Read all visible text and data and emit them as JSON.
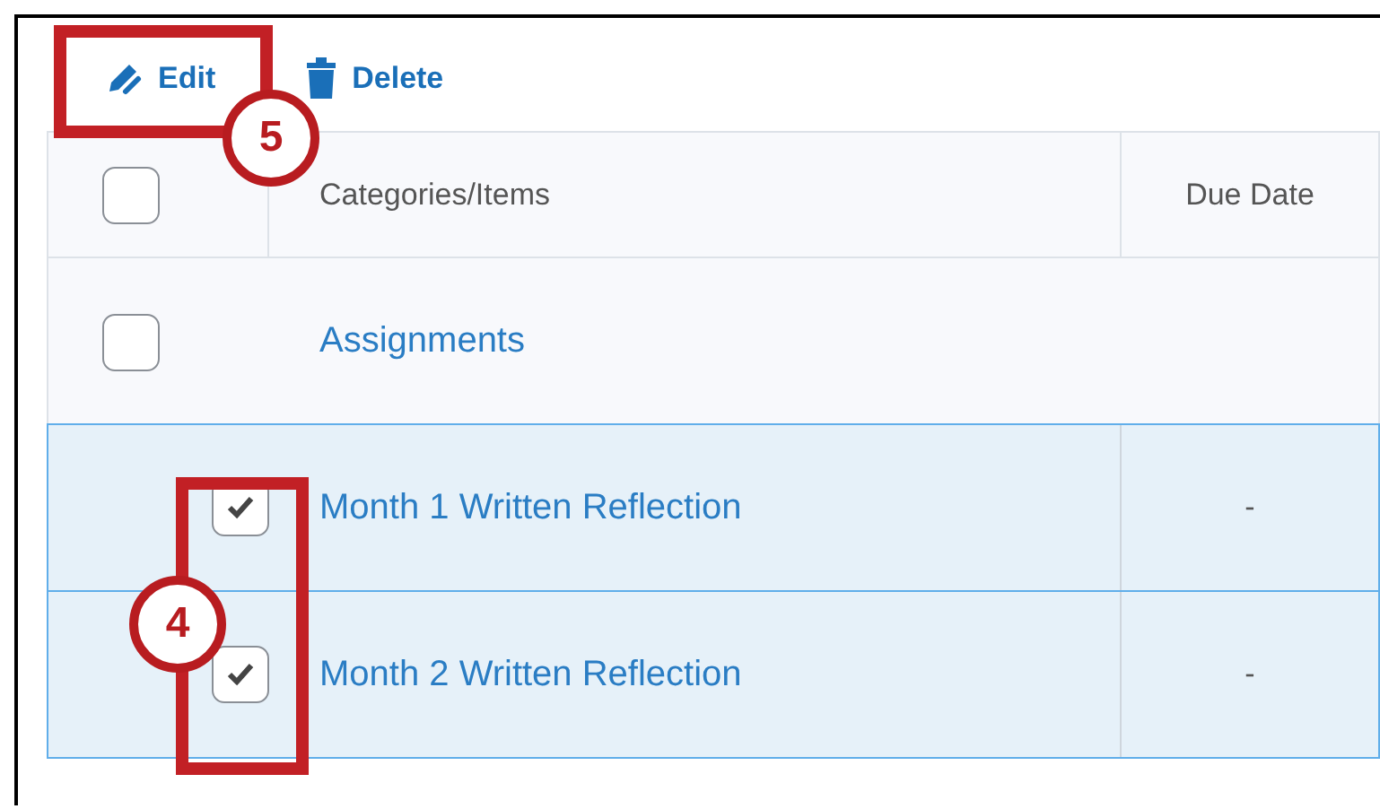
{
  "toolbar": [
    {
      "kind": "edit",
      "label": "Edit"
    },
    {
      "kind": "delete",
      "label": "Delete"
    }
  ],
  "table": {
    "header_checked": false,
    "columns": [
      "Categories/Items",
      "Due Date"
    ],
    "rows": [
      {
        "kind": "category",
        "title": "Assignments",
        "checked": false,
        "selected": false
      },
      {
        "kind": "item",
        "title": "Month 1 Written Reflection",
        "due": "-",
        "checked": true,
        "selected": true
      },
      {
        "kind": "item",
        "title": "Month 2 Written Reflection",
        "due": "-",
        "checked": true,
        "selected": true
      }
    ]
  },
  "callouts": [
    {
      "number": "5"
    },
    {
      "number": "4"
    }
  ]
}
